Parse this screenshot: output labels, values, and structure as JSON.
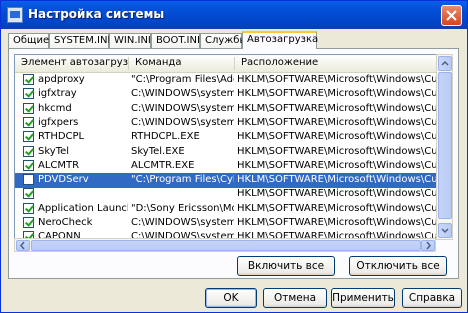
{
  "window": {
    "title": "Настройка системы"
  },
  "tabs": [
    {
      "label": "Общие"
    },
    {
      "label": "SYSTEM.INI"
    },
    {
      "label": "WIN.INI"
    },
    {
      "label": "BOOT.INI"
    },
    {
      "label": "Службы"
    },
    {
      "label": "Автозагрузка"
    }
  ],
  "active_tab": "Автозагрузка",
  "startup_list": {
    "columns": [
      "Элемент автозагрузки",
      "Команда",
      "Расположение"
    ],
    "rows": [
      {
        "checked": true,
        "item": "apdproxy",
        "command": "\"C:\\Program Files\\Ado...",
        "location": "HKLM\\SOFTWARE\\Microsoft\\Windows\\CurrentVer..."
      },
      {
        "checked": true,
        "item": "igfxtray",
        "command": "C:\\WINDOWS\\system...",
        "location": "HKLM\\SOFTWARE\\Microsoft\\Windows\\CurrentVer..."
      },
      {
        "checked": true,
        "item": "hkcmd",
        "command": "C:\\WINDOWS\\system...",
        "location": "HKLM\\SOFTWARE\\Microsoft\\Windows\\CurrentVer..."
      },
      {
        "checked": true,
        "item": "igfxpers",
        "command": "C:\\WINDOWS\\system...",
        "location": "HKLM\\SOFTWARE\\Microsoft\\Windows\\CurrentVer..."
      },
      {
        "checked": true,
        "item": "RTHDCPL",
        "command": "RTHDCPL.EXE",
        "location": "HKLM\\SOFTWARE\\Microsoft\\Windows\\CurrentVer..."
      },
      {
        "checked": true,
        "item": "SkyTel",
        "command": "SkyTel.EXE",
        "location": "HKLM\\SOFTWARE\\Microsoft\\Windows\\CurrentVer..."
      },
      {
        "checked": true,
        "item": "ALCMTR",
        "command": "ALCMTR.EXE",
        "location": "HKLM\\SOFTWARE\\Microsoft\\Windows\\CurrentVer..."
      },
      {
        "checked": false,
        "item": "PDVDServ",
        "command": "\"C:\\Program Files\\Cyb...",
        "location": "HKLM\\SOFTWARE\\Microsoft\\Windows\\CurrentVer...",
        "selected": true
      },
      {
        "checked": true,
        "item": "",
        "command": "",
        "location": "HKLM\\SOFTWARE\\Microsoft\\Windows\\CurrentVer..."
      },
      {
        "checked": true,
        "item": "Application Launcher",
        "command": "\"D:\\Sony Ericsson\\Mo...",
        "location": "HKLM\\SOFTWARE\\Microsoft\\Windows\\CurrentVer..."
      },
      {
        "checked": true,
        "item": "NeroCheck",
        "command": "C:\\WINDOWS\\system...",
        "location": "HKLM\\SOFTWARE\\Microsoft\\Windows\\CurrentVer..."
      },
      {
        "checked": true,
        "item": "CAPONN",
        "command": "C:\\WINDOWS\\system...",
        "location": "HKLM\\SOFTWARE\\Microsoft\\Windows\\CurrentVer..."
      }
    ]
  },
  "panel_buttons": {
    "enable_all": "Включить все",
    "disable_all": "Отключить все"
  },
  "dialog_buttons": {
    "ok": "OK",
    "cancel": "Отмена",
    "apply": "Применить",
    "help": "Справка"
  },
  "icons": {
    "title": "system-config-icon",
    "close": "close-icon"
  },
  "colors": {
    "titlebar": "#0350D6",
    "selection": "#316AC5",
    "face": "#ECE9D8",
    "active_tab_accent": "#FFC83C"
  }
}
